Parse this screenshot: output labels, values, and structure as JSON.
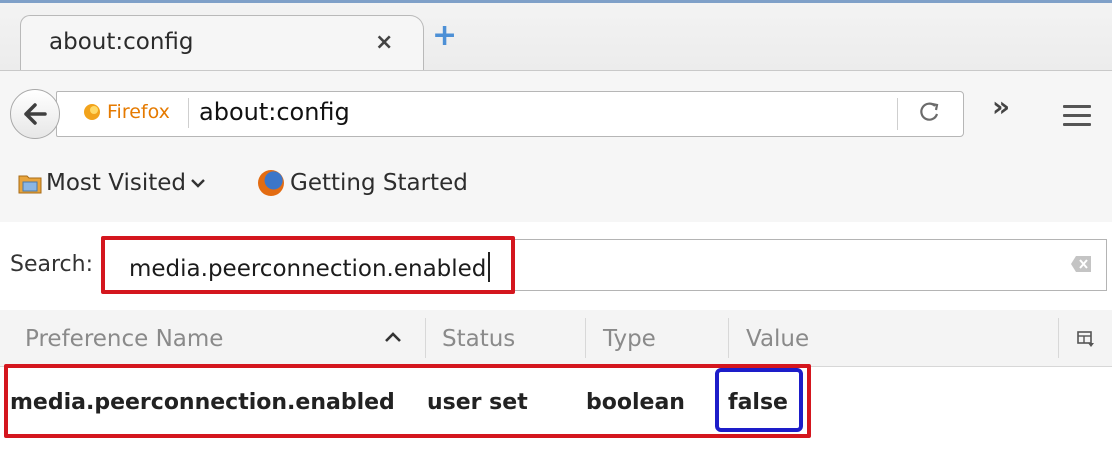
{
  "tab": {
    "title": "about:config",
    "close": "×",
    "new_tab": "+"
  },
  "navbar": {
    "identity_label": "Firefox",
    "url": "about:config",
    "reload": "C",
    "overflow": "»"
  },
  "bookmarks": {
    "items": [
      {
        "label": "Most Visited",
        "dropdown": "v"
      },
      {
        "label": "Getting Started"
      }
    ]
  },
  "search": {
    "label": "Search:",
    "value": "media.peerconnection.enabled"
  },
  "table": {
    "columns": [
      "Preference Name",
      "Status",
      "Type",
      "Value"
    ],
    "sort_indicator": "^",
    "rows": [
      {
        "name": "media.peerconnection.enabled",
        "status": "user set",
        "type": "boolean",
        "value": "false"
      }
    ]
  },
  "colors": {
    "highlight_red": "#d4161e",
    "highlight_blue": "#1d1dc9",
    "identity_orange": "#e57a00",
    "new_tab_blue": "#4d90d6"
  },
  "icons": [
    "back-arrow-icon",
    "firefox-identity-icon",
    "reload-icon",
    "overflow-chevron-icon",
    "hamburger-menu-icon",
    "folder-icon",
    "firefox-logo-icon",
    "clear-search-icon",
    "column-picker-icon",
    "sort-ascending-icon"
  ]
}
